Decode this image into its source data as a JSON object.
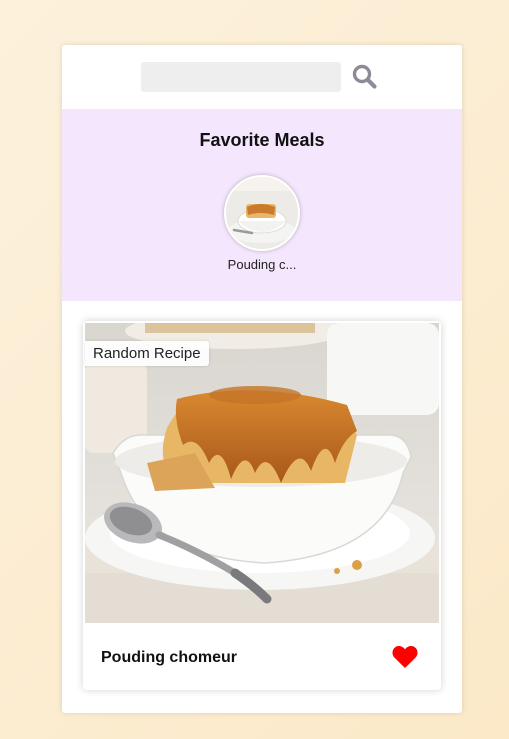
{
  "header": {
    "search_value": "",
    "search_placeholder": "",
    "search_icon": "search-icon"
  },
  "favorites": {
    "title": "Favorite Meals",
    "items": [
      {
        "name": "Pouding c..."
      }
    ]
  },
  "meal_card": {
    "tag": "Random Recipe",
    "name": "Pouding chomeur",
    "favorite_icon": "heart-icon",
    "favorite_color": "#ff0000"
  },
  "colors": {
    "favorites_bg": "#f4e6fd",
    "search_icon": "#8f8a96"
  }
}
